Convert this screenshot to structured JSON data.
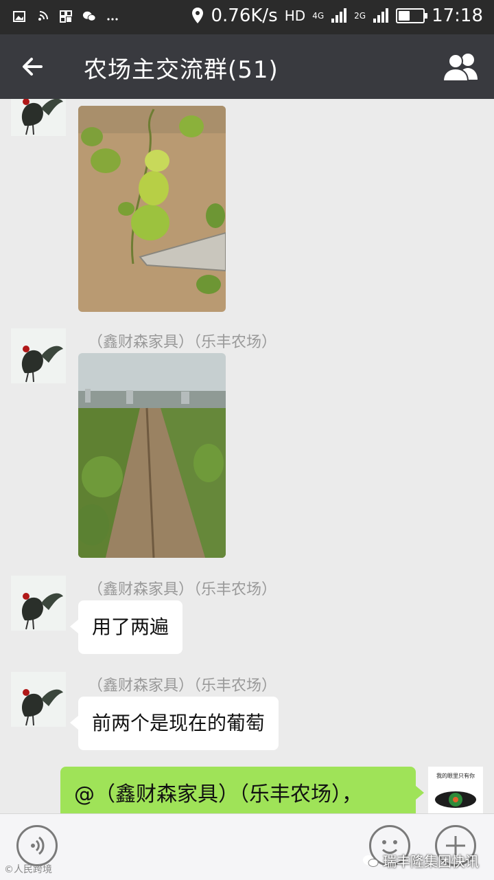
{
  "status_bar": {
    "network_speed": "0.76K/s",
    "hd": "HD",
    "net1": "4G",
    "net2": "2G",
    "time": "17:18",
    "battery_level": 0.5,
    "icons": [
      "image-icon",
      "signal-cast-icon",
      "app-grid-icon",
      "wechat-icon",
      "more-dots-icon",
      "location-pin-icon",
      "signal-bars-icon",
      "battery-icon"
    ]
  },
  "header": {
    "title": "农场主交流群(51)",
    "back_icon": "back-arrow-icon",
    "group_icon": "group-members-icon"
  },
  "messages": [
    {
      "type": "image",
      "sender": "",
      "photo": "grape-seedling-closeup"
    },
    {
      "type": "image",
      "sender": "（鑫财森家具）（乐丰农场）",
      "photo": "grape-field-rows"
    },
    {
      "type": "text",
      "sender": "（鑫财森家具）（乐丰农场）",
      "text": "用了两遍"
    },
    {
      "type": "text",
      "sender": "（鑫财森家具）（乐丰农场）",
      "text": "前两个是现在的葡萄"
    },
    {
      "type": "text",
      "mine": true,
      "text": "@（鑫财森家具）（乐丰农场），",
      "avatar_caption": "我的眼里只有你"
    }
  ],
  "input_bar": {
    "voice_icon": "voice-input-icon",
    "emoji_icon": "emoji-icon",
    "plus_icon": "plus-icon"
  },
  "watermarks": {
    "left": "©人民跨境",
    "right": "瑞丰隆集团快讯"
  },
  "colors": {
    "header_bg": "#393a3f",
    "status_bg": "#2b2b2b",
    "chat_bg": "#ebebeb",
    "my_bubble": "#9fe358"
  }
}
